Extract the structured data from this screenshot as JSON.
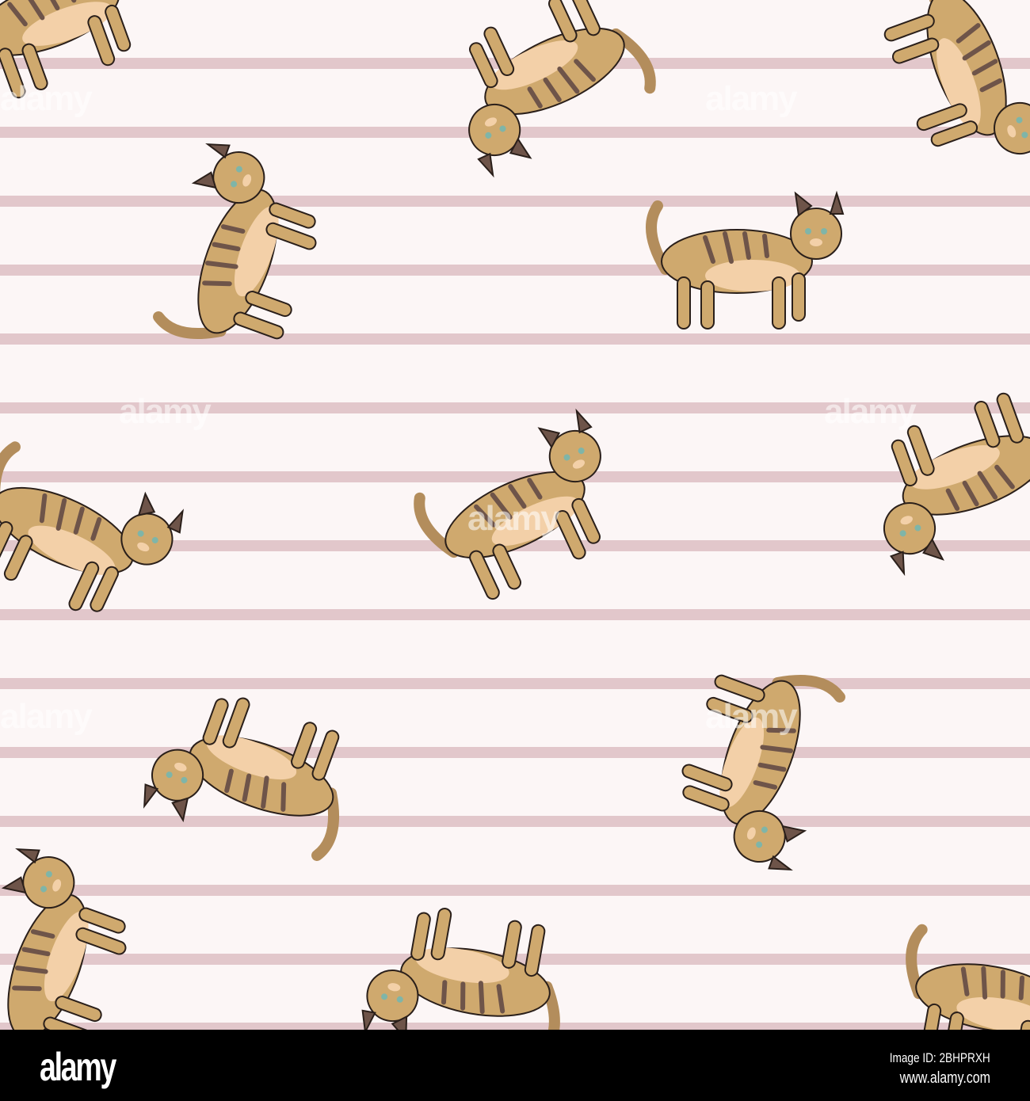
{
  "image": {
    "description_label": "Seamless pattern of tabby cats on pink stripes",
    "colors": {
      "stripe_pink": "#e2c7cb",
      "stripe_white": "#fcf6f6",
      "cat_body": "#cfa96e",
      "cat_belly": "#f3d0a8",
      "cat_stripe": "#6e5449"
    },
    "watermark": "alamy"
  },
  "footer": {
    "logo": "alamy",
    "image_id": "Image ID: 2BHPRXH",
    "website": "www.alamy.com"
  }
}
